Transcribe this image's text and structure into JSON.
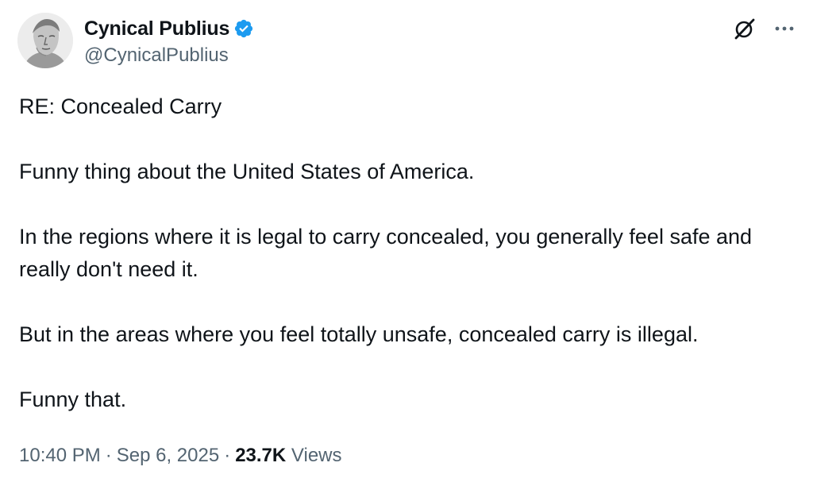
{
  "author": {
    "display_name": "Cynical Publius",
    "handle": "@CynicalPublius",
    "verified": true,
    "verified_color": "#1d9bf0"
  },
  "tweet": {
    "paragraphs": [
      "RE: Concealed Carry",
      "Funny thing about the United States of America.",
      "In the regions where it is legal to carry concealed, you generally feel safe and really don't need it.",
      "But in the areas where you feel totally unsafe, concealed carry is illegal.",
      "Funny that."
    ]
  },
  "meta": {
    "time": "10:40 PM",
    "separator": "·",
    "date": "Sep 6, 2025",
    "views_count": "23.7K",
    "views_label": "Views"
  },
  "icons": {
    "grok": "grok-icon",
    "more": "more-options-icon",
    "verified": "verified-badge-icon"
  }
}
